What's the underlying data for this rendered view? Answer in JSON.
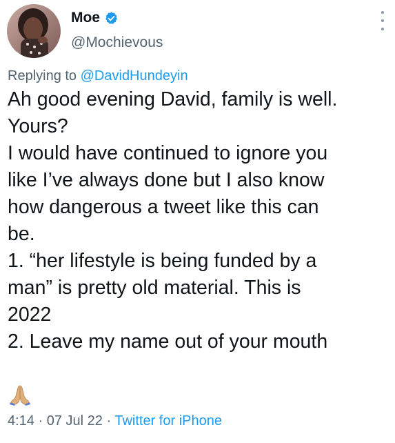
{
  "author": {
    "display_name": "Moe",
    "handle": "@Mochievous",
    "verified": true
  },
  "reply": {
    "prefix": "Replying to",
    "mention": "@DavidHundeyin"
  },
  "body_lines": [
    "Ah good evening David, family is well.",
    "Yours?",
    "I would have continued to ignore you",
    "like I’ve always done but I also know",
    "how dangerous a tweet like this can",
    "be.",
    "1. “her lifestyle is being funded by a",
    "man” is pretty old material. This is",
    "2022",
    "2. Leave my name out of your mouth"
  ],
  "emoji": "folded-hands",
  "meta": {
    "time": "4:14",
    "separator": "·",
    "date": "07 Jul 22",
    "source": "Twitter for iPhone"
  },
  "colors": {
    "accent": "#1d9bf0",
    "muted": "#536471",
    "text": "#0f1419"
  }
}
